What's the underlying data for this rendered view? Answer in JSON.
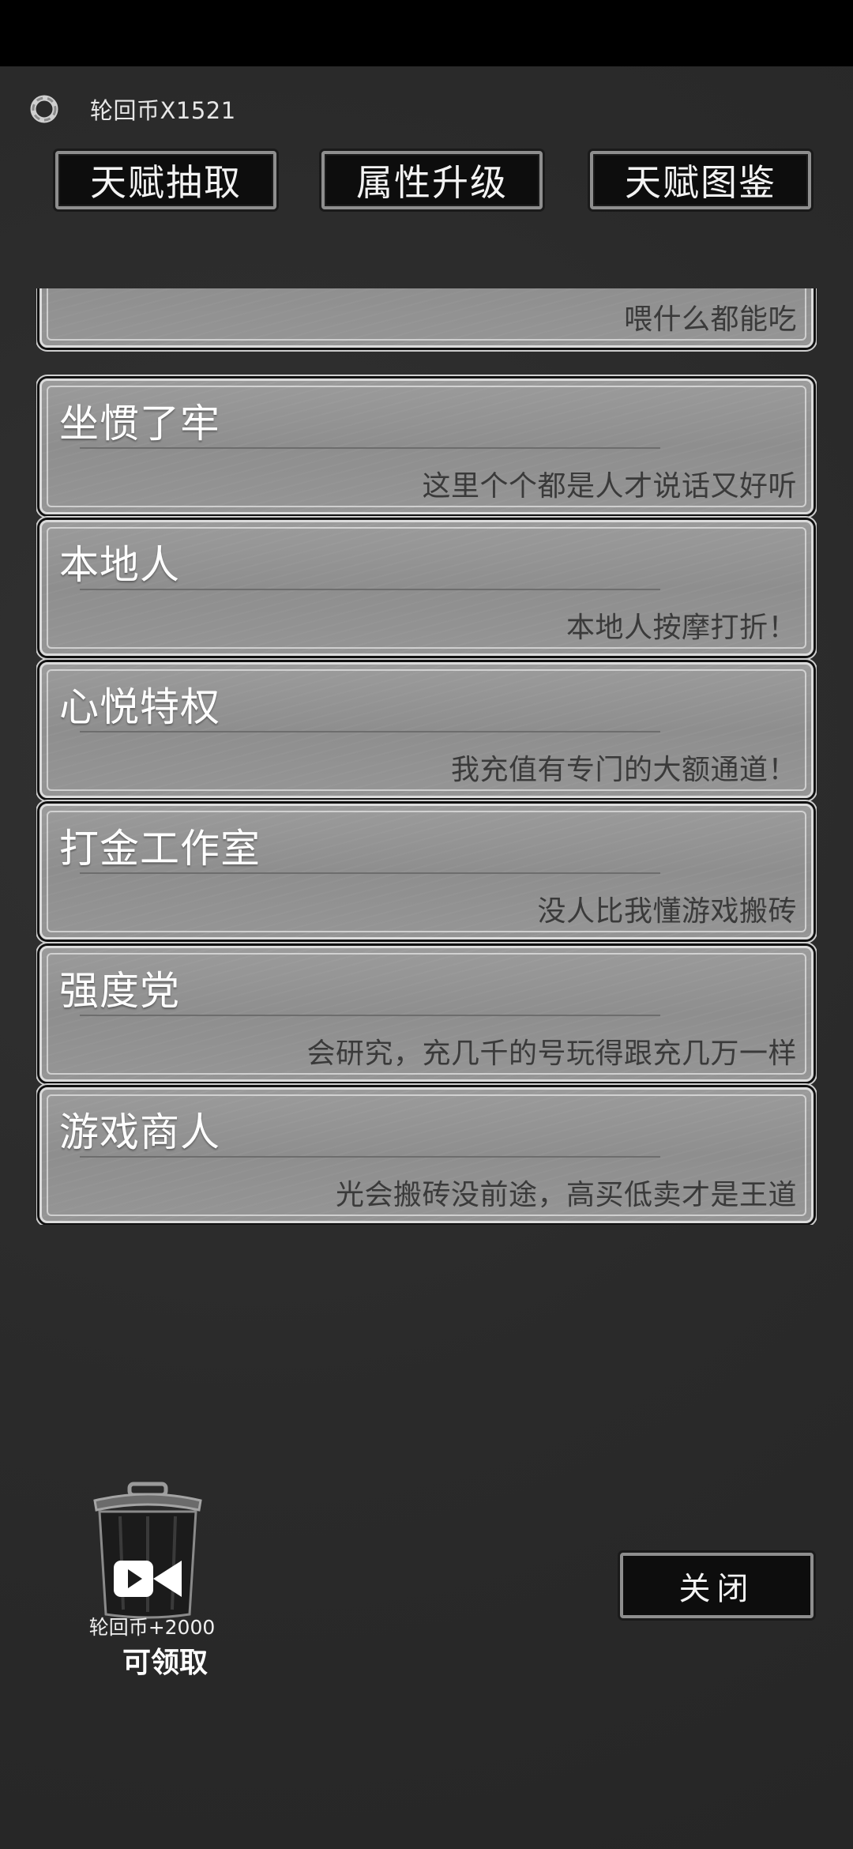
{
  "header": {
    "coin_label": "轮回币X1521",
    "tabs": [
      "天赋抽取",
      "属性升级",
      "天赋图鉴"
    ]
  },
  "talents": [
    {
      "name": "",
      "desc": "喂什么都能吃"
    },
    {
      "name": "坐惯了牢",
      "desc": "这里个个都是人才说话又好听"
    },
    {
      "name": "本地人",
      "desc": "本地人按摩打折！"
    },
    {
      "name": "心悦特权",
      "desc": "我充值有专门的大额通道！"
    },
    {
      "name": "打金工作室",
      "desc": "没人比我懂游戏搬砖"
    },
    {
      "name": "强度党",
      "desc": "会研究，充几千的号玩得跟充几万一样"
    },
    {
      "name": "游戏商人",
      "desc": "光会搬砖没前途，高买低卖才是王道"
    }
  ],
  "reward": {
    "label": "轮回币+2000",
    "claim": "可领取",
    "icon": "video-ad-icon"
  },
  "close_label": "关闭",
  "colors": {
    "background": "#2b2b2b",
    "card": "#959595",
    "button": "#0d0d0d"
  }
}
